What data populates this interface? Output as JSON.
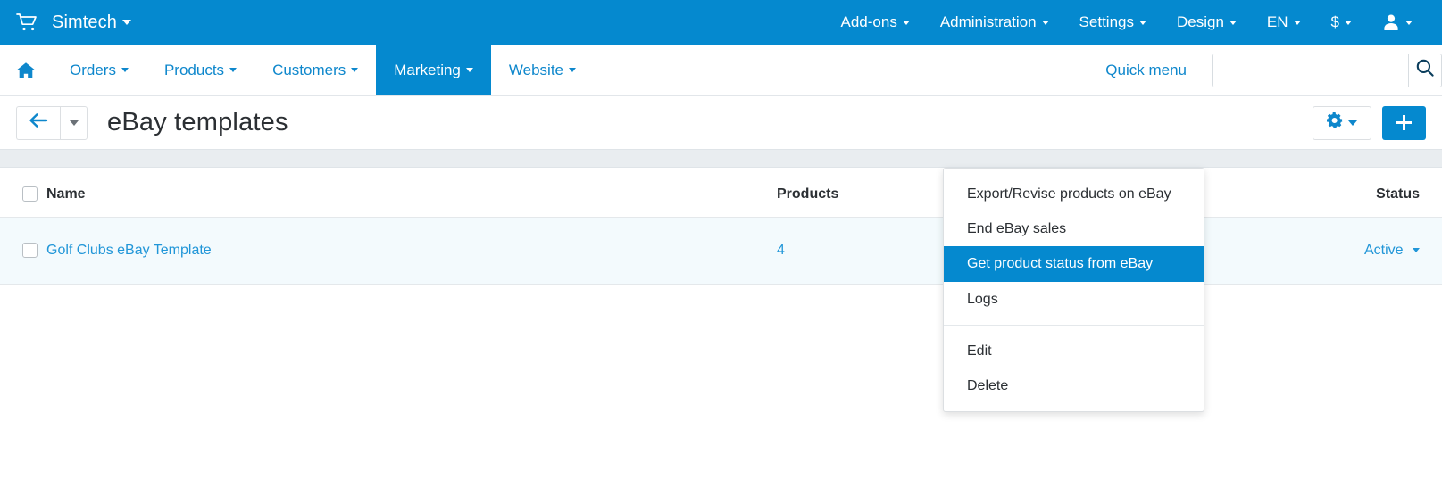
{
  "topbar": {
    "cart_icon": "cart-icon",
    "brand": "Simtech",
    "menu": [
      {
        "label": "Add-ons",
        "caret": true
      },
      {
        "label": "Administration",
        "caret": true
      },
      {
        "label": "Settings",
        "caret": true
      },
      {
        "label": "Design",
        "caret": true
      },
      {
        "label": "EN",
        "caret": true
      },
      {
        "label": "$",
        "caret": true
      }
    ],
    "user_icon": "user-icon",
    "bg_color": "#0589cf"
  },
  "subnav": {
    "home_icon": "home-icon",
    "items": [
      {
        "label": "Orders",
        "active": false
      },
      {
        "label": "Products",
        "active": false
      },
      {
        "label": "Customers",
        "active": false
      },
      {
        "label": "Marketing",
        "active": true
      },
      {
        "label": "Website",
        "active": false
      }
    ],
    "quick_menu": "Quick menu",
    "search": {
      "value": "",
      "placeholder": "",
      "icon": "search-icon"
    }
  },
  "titlebar": {
    "back_icon": "arrow-left-icon",
    "title": "eBay templates",
    "gear_icon": "gear-icon",
    "add_icon": "plus-icon"
  },
  "table": {
    "headers": {
      "name": "Name",
      "products": "Products",
      "status": "Status"
    },
    "rows": [
      {
        "name": "Golf Clubs eBay Template",
        "products": "4",
        "status": "Active",
        "checked": false
      }
    ]
  },
  "dropdown": {
    "open": true,
    "items": [
      {
        "label": "Export/Revise products on eBay",
        "highlighted": false,
        "divider_after": false
      },
      {
        "label": "End eBay sales",
        "highlighted": false,
        "divider_after": false
      },
      {
        "label": "Get product status from eBay",
        "highlighted": true,
        "divider_after": false
      },
      {
        "label": "Logs",
        "highlighted": false,
        "divider_after": true
      },
      {
        "label": "Edit",
        "highlighted": false,
        "divider_after": false
      },
      {
        "label": "Delete",
        "highlighted": false,
        "divider_after": false
      }
    ],
    "highlight_color": "#0589cf"
  }
}
